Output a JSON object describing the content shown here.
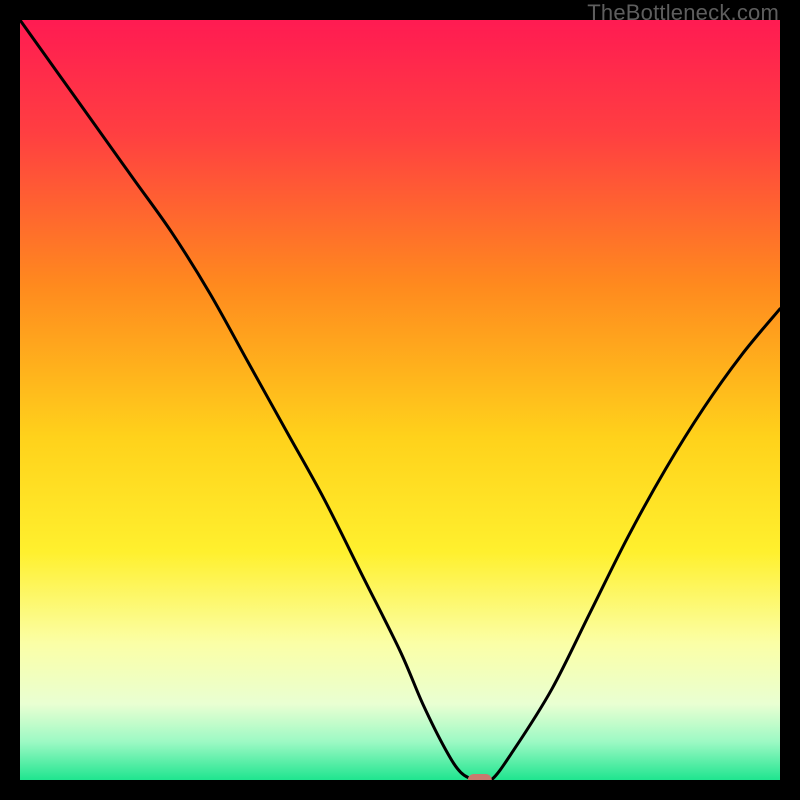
{
  "watermark": "TheBottleneck.com",
  "chart_data": {
    "type": "line",
    "title": "",
    "xlabel": "",
    "ylabel": "",
    "xlim": [
      0,
      100
    ],
    "ylim": [
      0,
      100
    ],
    "gradient_stops": [
      {
        "pos": 0.0,
        "color": "#ff1b52"
      },
      {
        "pos": 0.15,
        "color": "#ff3f41"
      },
      {
        "pos": 0.35,
        "color": "#ff8a1e"
      },
      {
        "pos": 0.55,
        "color": "#ffd21b"
      },
      {
        "pos": 0.7,
        "color": "#fff02e"
      },
      {
        "pos": 0.82,
        "color": "#fbffa6"
      },
      {
        "pos": 0.9,
        "color": "#e9ffd2"
      },
      {
        "pos": 0.95,
        "color": "#9cf9c4"
      },
      {
        "pos": 1.0,
        "color": "#1fe58f"
      }
    ],
    "series": [
      {
        "name": "bottleneck-curve",
        "x": [
          0,
          5,
          10,
          15,
          20,
          25,
          30,
          35,
          40,
          45,
          50,
          53,
          56,
          58,
          60,
          62,
          65,
          70,
          75,
          80,
          85,
          90,
          95,
          100
        ],
        "y": [
          100,
          93,
          86,
          79,
          72,
          64,
          55,
          46,
          37,
          27,
          17,
          10,
          4,
          1,
          0,
          0,
          4,
          12,
          22,
          32,
          41,
          49,
          56,
          62
        ]
      }
    ],
    "marker": {
      "x": 60.5,
      "y": 0,
      "color": "#c97a6e",
      "rx": 12,
      "ry": 6
    },
    "optimum": {
      "x_range": [
        58,
        62
      ],
      "y": 0
    }
  }
}
